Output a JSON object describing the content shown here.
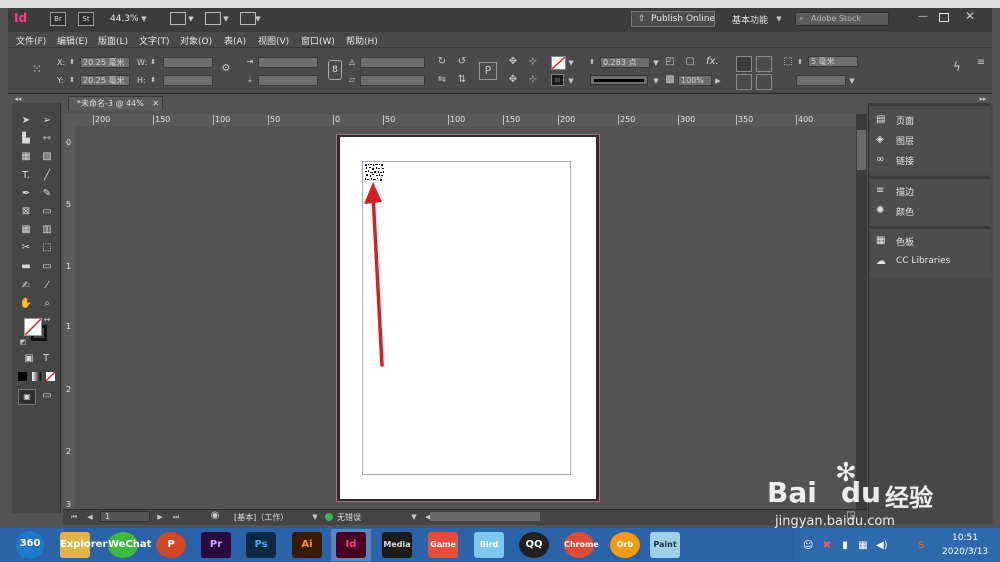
{
  "app": {
    "logo": "Id",
    "bridge_btn": "Br",
    "stock_btn": "St",
    "zoom": "44.3%",
    "publish_label": "Publish Online",
    "workspace": "基本功能",
    "search_placeholder": "Adobe Stock",
    "window_controls": [
      "minimize-icon",
      "restore-icon",
      "close-icon"
    ]
  },
  "menu": [
    "文件(F)",
    "编辑(E)",
    "版面(L)",
    "文字(T)",
    "对象(O)",
    "表(A)",
    "视图(V)",
    "窗口(W)",
    "帮助(H)"
  ],
  "control": {
    "x_label": "X:",
    "x_value": "20.25 毫米",
    "y_label": "Y:",
    "y_value": "20.25 毫米",
    "w_label": "W:",
    "h_label": "H:",
    "stroke_weight": "0.283 点",
    "opacity": "100%",
    "fx_label": "fx.",
    "gap_value": "5 毫米"
  },
  "document": {
    "tab_title": "*未命名-3 @ 44%",
    "ruler_h_ticks": [
      "200",
      "150",
      "100",
      "50",
      "0",
      "50",
      "100",
      "150",
      "200",
      "250",
      "300",
      "350",
      "400"
    ],
    "ruler_v_ticks": [
      "0",
      "5",
      "1",
      "1",
      "2",
      "2",
      "3"
    ]
  },
  "status": {
    "page_number": "1",
    "master": "[基本]（工作）",
    "preflight": "无错误",
    "preflight_color": "#3fb34f"
  },
  "panels": [
    {
      "icon": "pages-icon",
      "label": "页面"
    },
    {
      "icon": "layers-icon",
      "label": "图层"
    },
    {
      "icon": "links-icon",
      "label": "链接"
    },
    {
      "icon": "stroke-icon",
      "label": "描边"
    },
    {
      "icon": "color-icon",
      "label": "颜色"
    },
    {
      "icon": "swatches-icon",
      "label": "色板"
    },
    {
      "icon": "cc-libraries-icon",
      "label": "CC Libraries"
    }
  ],
  "taskbar": {
    "apps": [
      "360",
      "Explorer",
      "WeChat",
      "P",
      "Pr",
      "Ps",
      "Ai",
      "Id",
      "Media",
      "Game",
      "Bird",
      "QQ",
      "Chrome",
      "Orb",
      "Paint"
    ],
    "time": "10:51",
    "date": "2020/3/13"
  },
  "watermark": {
    "brand": "Bai",
    "brand2": "du",
    "cn": "经验",
    "url": "jingyan.baidu.com"
  },
  "colors": {
    "accent_arrow": "#d42020",
    "app_logo": "#ff3366",
    "taskbar": "#2a63a8"
  }
}
